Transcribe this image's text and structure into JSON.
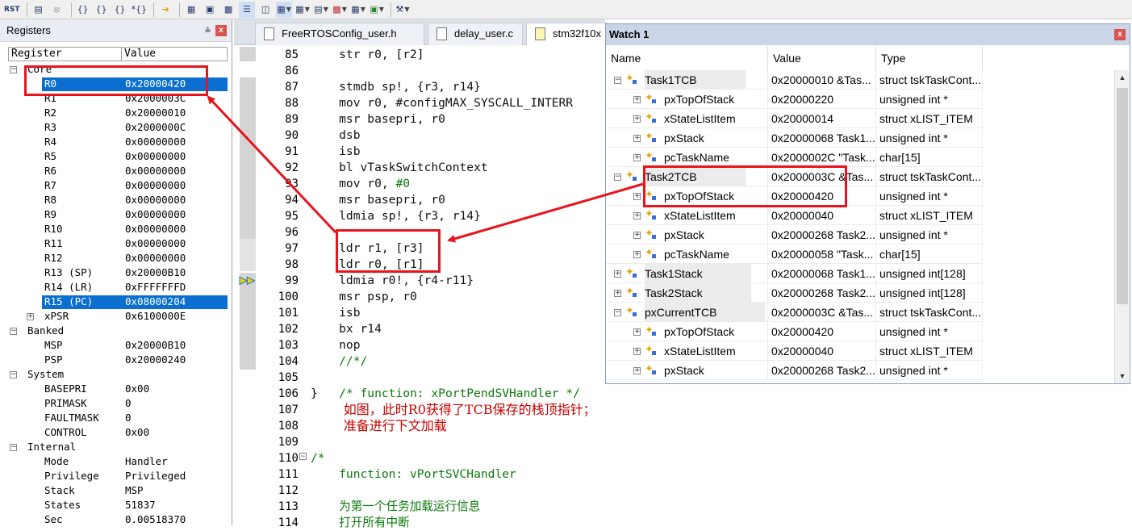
{
  "toolbar": {
    "buttons": [
      "RST",
      "disasm-icon",
      "stop-icon",
      "{}",
      "{}",
      "{}",
      "{}",
      "run-to-cursor-icon",
      "command-window-icon",
      "disassembly-window-icon",
      "symbols-window-icon",
      "registers-window-icon",
      "call-stack-icon",
      "watch-window-icon",
      "memory-window-icon",
      "serial-window-icon",
      "analysis-window-icon",
      "trace-window-icon",
      "system-viewer-icon",
      "toolbox-icon"
    ]
  },
  "registers": {
    "title": "Registers",
    "pin": "⩮",
    "close": "x",
    "col_register": "Register",
    "col_value": "Value",
    "groups": [
      {
        "name": "Core",
        "rows": [
          {
            "name": "R0",
            "value": "0x20000420",
            "selected": true
          },
          {
            "name": "R1",
            "value": "0x2000003C"
          },
          {
            "name": "R2",
            "value": "0x20000010"
          },
          {
            "name": "R3",
            "value": "0x2000000C"
          },
          {
            "name": "R4",
            "value": "0x00000000"
          },
          {
            "name": "R5",
            "value": "0x00000000"
          },
          {
            "name": "R6",
            "value": "0x00000000"
          },
          {
            "name": "R7",
            "value": "0x00000000"
          },
          {
            "name": "R8",
            "value": "0x00000000"
          },
          {
            "name": "R9",
            "value": "0x00000000"
          },
          {
            "name": "R10",
            "value": "0x00000000"
          },
          {
            "name": "R11",
            "value": "0x00000000"
          },
          {
            "name": "R12",
            "value": "0x00000000"
          },
          {
            "name": "R13 (SP)",
            "value": "0x20000B10"
          },
          {
            "name": "R14 (LR)",
            "value": "0xFFFFFFFD"
          },
          {
            "name": "R15 (PC)",
            "value": "0x08000204",
            "selected": true
          },
          {
            "name": "xPSR",
            "value": "0x6100000E",
            "expandable": true
          }
        ]
      },
      {
        "name": "Banked",
        "rows": [
          {
            "name": "MSP",
            "value": "0x20000B10"
          },
          {
            "name": "PSP",
            "value": "0x20000240"
          }
        ]
      },
      {
        "name": "System",
        "rows": [
          {
            "name": "BASEPRI",
            "value": "0x00"
          },
          {
            "name": "PRIMASK",
            "value": "0"
          },
          {
            "name": "FAULTMASK",
            "value": "0"
          },
          {
            "name": "CONTROL",
            "value": "0x00"
          }
        ]
      },
      {
        "name": "Internal",
        "rows": [
          {
            "name": "Mode",
            "value": "Handler"
          },
          {
            "name": "Privilege",
            "value": "Privileged"
          },
          {
            "name": "Stack",
            "value": "MSP"
          },
          {
            "name": "States",
            "value": "51837"
          },
          {
            "name": "Sec",
            "value": "0.00518370"
          }
        ]
      }
    ]
  },
  "editor": {
    "tabs": [
      "FreeRTOSConfig_user.h",
      "delay_user.c",
      "stm32f10x"
    ],
    "lines": [
      {
        "n": "85",
        "text": "    str r0, [r2]"
      },
      {
        "n": "86",
        "text": ""
      },
      {
        "n": "87",
        "text": "    stmdb sp!, {r3, r14}"
      },
      {
        "n": "88",
        "text": "    mov r0, #configMAX_SYSCALL_INTERR"
      },
      {
        "n": "89",
        "text": "    msr basepri, r0"
      },
      {
        "n": "90",
        "text": "    dsb"
      },
      {
        "n": "91",
        "text": "    isb"
      },
      {
        "n": "92",
        "text": "    bl vTaskSwitchContext"
      },
      {
        "n": "93",
        "text": "    mov r0, ",
        "num": "#0"
      },
      {
        "n": "94",
        "text": "    msr basepri, r0"
      },
      {
        "n": "95",
        "text": "    ldmia sp!, {r3, r14}"
      },
      {
        "n": "96",
        "text": ""
      },
      {
        "n": "97",
        "text": "    ldr r1, [r3]"
      },
      {
        "n": "98",
        "text": "    ldr r0, [r1]"
      },
      {
        "n": "99",
        "text": "    ldmia r0!, {r4-r11}"
      },
      {
        "n": "100",
        "text": "    msr psp, r0"
      },
      {
        "n": "101",
        "text": "    isb"
      },
      {
        "n": "102",
        "text": "    bx r14"
      },
      {
        "n": "103",
        "text": "    nop"
      },
      {
        "n": "104",
        "text": "    //*/",
        "comment": true
      },
      {
        "n": "105",
        "text": ""
      },
      {
        "n": "106",
        "text": "}   ",
        "tail": "/* function: xPortPendSVHandler */"
      },
      {
        "n": "107",
        "text": "",
        "cn": "        如图，此时R0获得了TCB保存的栈顶指针；"
      },
      {
        "n": "108",
        "text": "",
        "cn": "        准备进行下文加载"
      },
      {
        "n": "109",
        "text": ""
      },
      {
        "n": "110",
        "text": "/*",
        "comment": true
      },
      {
        "n": "111",
        "text": "    function: vPortSVCHandler",
        "comment": true
      },
      {
        "n": "112",
        "text": ""
      },
      {
        "n": "113",
        "text": "    为第一个任务加载运行信息",
        "comment": true
      },
      {
        "n": "114",
        "text": "    打开所有中断",
        "comment": true
      }
    ]
  },
  "watch": {
    "title": "Watch 1",
    "close": "x",
    "col_name": "Name",
    "col_value": "Value",
    "col_type": "Type",
    "rows": [
      {
        "level": 0,
        "exp": "-",
        "name": "Task1TCB",
        "value": "0x20000010 &Tas...",
        "type": "struct tskTaskCont..."
      },
      {
        "level": 1,
        "exp": "+",
        "name": "pxTopOfStack",
        "value": "0x20000220",
        "type": "unsigned int *"
      },
      {
        "level": 1,
        "exp": "+",
        "name": "xStateListItem",
        "value": "0x20000014",
        "type": "struct xLIST_ITEM"
      },
      {
        "level": 1,
        "exp": "+",
        "name": "pxStack",
        "value": "0x20000068 Task1...",
        "type": "unsigned int *"
      },
      {
        "level": 1,
        "exp": "+",
        "name": "pcTaskName",
        "value": "0x2000002C \"Task...",
        "type": "char[15]"
      },
      {
        "level": 0,
        "exp": "-",
        "name": "Task2TCB",
        "value": "0x2000003C &Tas...",
        "type": "struct tskTaskCont..."
      },
      {
        "level": 1,
        "exp": "+",
        "name": "pxTopOfStack",
        "value": "0x20000420",
        "type": "unsigned int *"
      },
      {
        "level": 1,
        "exp": "+",
        "name": "xStateListItem",
        "value": "0x20000040",
        "type": "struct xLIST_ITEM"
      },
      {
        "level": 1,
        "exp": "+",
        "name": "pxStack",
        "value": "0x20000268 Task2...",
        "type": "unsigned int *"
      },
      {
        "level": 1,
        "exp": "+",
        "name": "pcTaskName",
        "value": "0x20000058 \"Task...",
        "type": "char[15]"
      },
      {
        "level": 0,
        "exp": "+",
        "name": "Task1Stack",
        "value": "0x20000068 Task1...",
        "type": "unsigned int[128]"
      },
      {
        "level": 0,
        "exp": "+",
        "name": "Task2Stack",
        "value": "0x20000268 Task2...",
        "type": "unsigned int[128]"
      },
      {
        "level": 0,
        "exp": "-",
        "name": "pxCurrentTCB",
        "value": "0x2000003C &Tas...",
        "type": "struct tskTaskCont..."
      },
      {
        "level": 1,
        "exp": "+",
        "name": "pxTopOfStack",
        "value": "0x20000420",
        "type": "unsigned int *"
      },
      {
        "level": 1,
        "exp": "+",
        "name": "xStateListItem",
        "value": "0x20000040",
        "type": "struct xLIST_ITEM"
      },
      {
        "level": 1,
        "exp": "+",
        "name": "pxStack",
        "value": "0x20000268 Task2...",
        "type": "unsigned int *"
      }
    ]
  },
  "colors": {
    "selection": "#0a6fd0",
    "annotation": "#e8141c",
    "comment": "#0b7a0b"
  }
}
